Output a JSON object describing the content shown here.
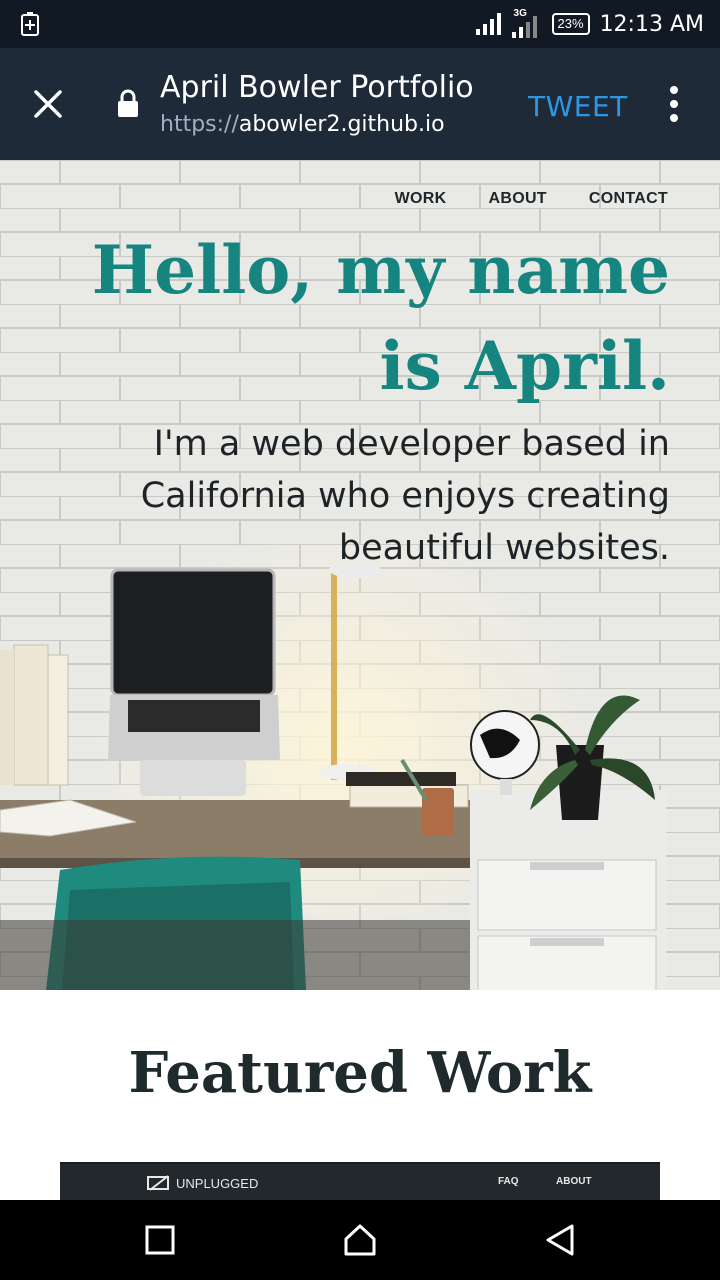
{
  "status_bar": {
    "network": "3G",
    "battery": "23%",
    "time": "12:13 AM"
  },
  "browser": {
    "title": "April Bowler Portfolio",
    "url_scheme": "https://",
    "url_host": "abowler2.github.io",
    "tweet_label": "TWEET"
  },
  "nav": {
    "work": "WORK",
    "about": "ABOUT",
    "contact": "CONTACT"
  },
  "hero": {
    "headline": "Hello, my name is April.",
    "subheadline": "I'm a web developer based in California who enjoys creating beautiful websites."
  },
  "featured": {
    "title": "Featured Work",
    "card_logo": "UNPLUGGED",
    "card_faq": "FAQ",
    "card_about": "ABOUT"
  },
  "colors": {
    "accent": "#168580",
    "toolbar": "#1e2a38",
    "tweet": "#2d97e6"
  }
}
